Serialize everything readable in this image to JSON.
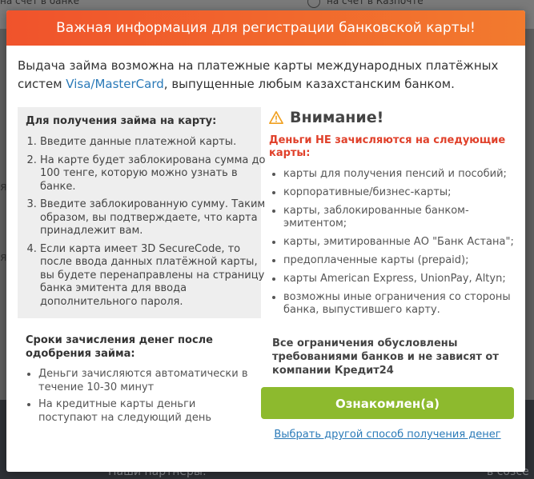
{
  "background": {
    "top_left": "на счет в банке",
    "top_right": "на счет в Казпочте",
    "bottom_left": "Наши партнеры:",
    "bottom_right": "в созсе"
  },
  "modal": {
    "title": "Важная информация для регистрации банковской карты!",
    "intro_before": "Выдача займа возможна на платежные карты международных платёжных систем ",
    "intro_link": "Visa/MasterCard",
    "intro_after": ", выпущенные любым казахстанским банком.",
    "steps": {
      "title": "Для получения займа на карту:",
      "items": [
        "Введите данные платежной карты.",
        "На карте будет заблокирована сумма до 100 тенге, которую можно узнать в банке.",
        "Введите заблокированную сумму. Таким образом, вы подтверждаете, что карта принадлежит вам.",
        "Если карта имеет 3D SecureCode, то после ввода данных платёжной карты, вы будете перенаправлены на страницу банка эмитента для ввода дополнительного пароля."
      ]
    },
    "terms": {
      "title": "Сроки зачисления денег после одобрения займа:",
      "items": [
        "Деньги зачисляются автоматически в течение 10-30 минут",
        "На кредитные карты деньги поступают на следующий день"
      ]
    },
    "warning": {
      "icon": "warning-icon",
      "title": "Внимание!",
      "subtitle": "Деньги НЕ зачисляются на следующие карты:",
      "items": [
        "карты для получения пенсий и пособий;",
        "корпоративные/бизнес-карты;",
        "карты, заблокированные банком-эмитентом;",
        "карты, эмитированные АО \"Банк Астана\";",
        "предоплаченные карты (prepaid);",
        "карты American Express, UnionPay, Altyn;",
        "возможны иные ограничения со стороны банка, выпустившего карту."
      ]
    },
    "note": "Все ограничения обусловлены требованиями банков и не зависят от компании Кредит24",
    "confirm_button": "Ознакомлен(а)",
    "other_method_link": "Выбрать другой способ получения денег"
  },
  "colors": {
    "header": "#f0532c",
    "button": "#8dba2e",
    "link": "#2a7ab8",
    "warning_text": "#e0402a"
  }
}
